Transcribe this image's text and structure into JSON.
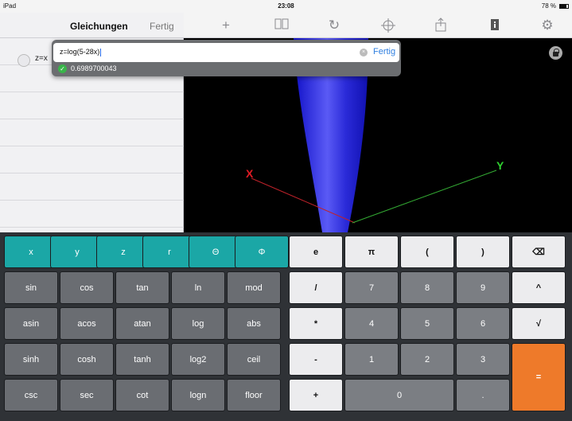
{
  "status": {
    "device": "iPad",
    "time": "23:08",
    "battery": "78 %"
  },
  "sidebar": {
    "title": "Gleichungen",
    "done": "Fertig",
    "equation_preview": "z=x"
  },
  "toolbar": {
    "icons": [
      "plus-icon",
      "book-icon",
      "refresh-icon",
      "crosshair-icon",
      "share-icon",
      "info-icon",
      "settings-icon"
    ]
  },
  "viewport": {
    "axis_x": "X",
    "axis_y": "Y"
  },
  "popover": {
    "input_value": "z=log(5-28x)",
    "done": "Fertig",
    "result": "0.6989700043"
  },
  "keypad": {
    "row1": [
      "x",
      "y",
      "z",
      "r",
      "Θ",
      "Φ",
      "e",
      "π",
      "(",
      ")",
      "⌫"
    ],
    "row2": [
      "sin",
      "cos",
      "tan",
      "ln",
      "mod",
      "/",
      "7",
      "8",
      "9",
      "^"
    ],
    "row3": [
      "asin",
      "acos",
      "atan",
      "log",
      "abs",
      "*",
      "4",
      "5",
      "6",
      "√"
    ],
    "row4": [
      "sinh",
      "cosh",
      "tanh",
      "log2",
      "ceil",
      "-",
      "1",
      "2",
      "3",
      "="
    ],
    "row5": [
      "csc",
      "sec",
      "cot",
      "logn",
      "floor",
      "+",
      "0",
      "."
    ]
  },
  "colors": {
    "accent_teal": "#1ba7a6",
    "accent_orange": "#ee7a2a",
    "link_blue": "#2f7fe0",
    "surface_blue": "#2a2ad8"
  }
}
